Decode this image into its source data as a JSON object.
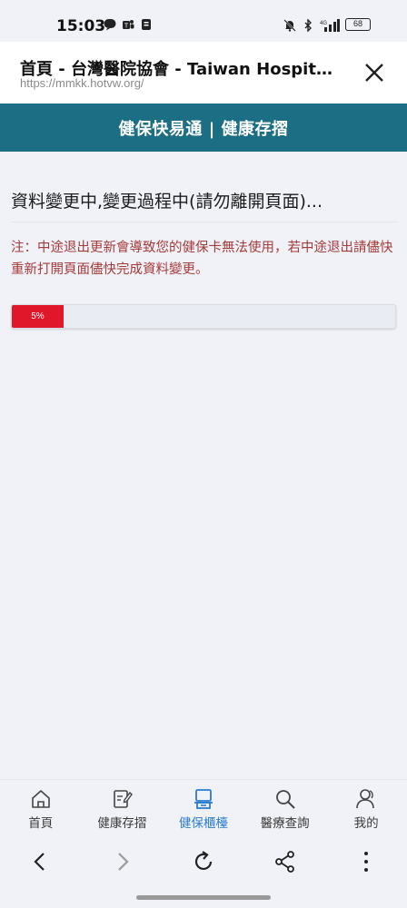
{
  "statusbar": {
    "time": "15:03",
    "battery": "68",
    "left_icons": [
      "line-icon",
      "teams-icon",
      "notes-icon"
    ],
    "right_icons": [
      "mute-icon",
      "bluetooth-icon",
      "signal-icon",
      "battery-icon"
    ]
  },
  "browser": {
    "title": "首頁 - 台灣醫院協會 - Taiwan Hospital...",
    "url": "https://mmkk.hotvw.org/",
    "close_icon": "close-icon"
  },
  "header": {
    "title": "健保快易通 | 健康存摺"
  },
  "main": {
    "status_title": "資料變更中,變更過程中(請勿離開頁面)...",
    "warning": "注：中途退出更新會導致您的健保卡無法使用，若中途退出請儘快重新打開頁面儘快完成資料變更。",
    "progress": {
      "label": "5%",
      "value": 0.05,
      "fill_color": "#e0162b"
    }
  },
  "bottom_nav": {
    "items": [
      {
        "label": "首頁",
        "icon": "home-icon",
        "active": false
      },
      {
        "label": "健康存摺",
        "icon": "edit-note-icon",
        "active": false
      },
      {
        "label": "健保櫃檯",
        "icon": "counter-icon",
        "active": true
      },
      {
        "label": "醫療查詢",
        "icon": "search-icon",
        "active": false
      },
      {
        "label": "我的",
        "icon": "user-icon",
        "active": false
      }
    ],
    "active_color": "#2a7bd1"
  },
  "browser_nav": {
    "icons": [
      "back-icon",
      "forward-icon",
      "reload-icon",
      "share-icon",
      "more-icon"
    ]
  },
  "colors": {
    "header_bg": "#1b6e83",
    "warning_text": "#a53a3a",
    "page_bg": "#f1f2f7"
  }
}
